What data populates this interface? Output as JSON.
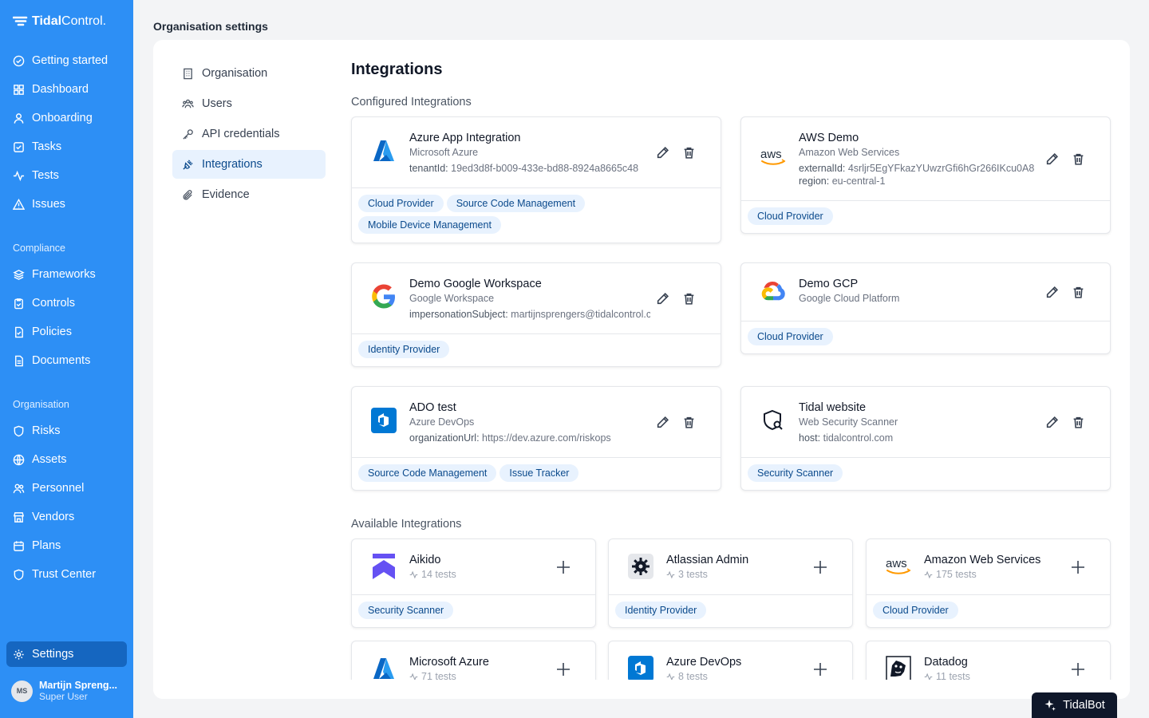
{
  "brand": {
    "part1": "Tidal",
    "part2": "Control."
  },
  "sidebar": {
    "main": [
      "Getting started",
      "Dashboard",
      "Onboarding",
      "Tasks",
      "Tests",
      "Issues"
    ],
    "compliance_label": "Compliance",
    "compliance": [
      "Frameworks",
      "Controls",
      "Policies",
      "Documents"
    ],
    "organisation_label": "Organisation",
    "organisation": [
      "Risks",
      "Assets",
      "Personnel",
      "Vendors",
      "Plans",
      "Trust Center"
    ],
    "settings": "Settings",
    "user": {
      "initials": "MS",
      "name": "Martijn Spreng...",
      "role": "Super User"
    }
  },
  "page": {
    "title": "Organisation settings"
  },
  "subnav": [
    "Organisation",
    "Users",
    "API credentials",
    "Integrations",
    "Evidence"
  ],
  "integrations": {
    "title": "Integrations",
    "configured_label": "Configured Integrations",
    "available_label": "Available Integrations",
    "configured": [
      {
        "name": "Azure App Integration",
        "provider": "Microsoft Azure",
        "meta": [
          {
            "k": "tenantId:",
            "v": "19ed3d8f-b009-433e-bd88-8924a8665c48"
          }
        ],
        "tags": [
          "Cloud Provider",
          "Source Code Management",
          "Mobile Device Management"
        ]
      },
      {
        "name": "AWS Demo",
        "provider": "Amazon Web Services",
        "meta": [
          {
            "k": "externalId:",
            "v": "4srljr5EgYFkazYUwzrGfi6hGr266IKcu0A8"
          },
          {
            "k": "region:",
            "v": "eu-central-1"
          }
        ],
        "tags": [
          "Cloud Provider"
        ]
      },
      {
        "name": "Demo Google Workspace",
        "provider": "Google Workspace",
        "meta": [
          {
            "k": "impersonationSubject:",
            "v": "martijnsprengers@tidalcontrol.com"
          }
        ],
        "tags": [
          "Identity Provider"
        ]
      },
      {
        "name": "Demo GCP",
        "provider": "Google Cloud Platform",
        "meta": [],
        "tags": [
          "Cloud Provider"
        ]
      },
      {
        "name": "ADO test",
        "provider": "Azure DevOps",
        "meta": [
          {
            "k": "organizationUrl:",
            "v": "https://dev.azure.com/riskops"
          }
        ],
        "tags": [
          "Source Code Management",
          "Issue Tracker"
        ]
      },
      {
        "name": "Tidal website",
        "provider": "Web Security Scanner",
        "meta": [
          {
            "k": "host:",
            "v": "tidalcontrol.com"
          }
        ],
        "tags": [
          "Security Scanner"
        ]
      }
    ],
    "available": [
      {
        "name": "Aikido",
        "tests": "14 tests",
        "tags": [
          "Security Scanner"
        ]
      },
      {
        "name": "Atlassian Admin",
        "tests": "3 tests",
        "tags": [
          "Identity Provider"
        ]
      },
      {
        "name": "Amazon Web Services",
        "tests": "175 tests",
        "tags": [
          "Cloud Provider"
        ]
      },
      {
        "name": "Microsoft Azure",
        "tests": "71 tests",
        "tags": []
      },
      {
        "name": "Azure DevOps",
        "tests": "8 tests",
        "tags": []
      },
      {
        "name": "Datadog",
        "tests": "11 tests",
        "tags": []
      }
    ]
  },
  "tidalbot": "TidalBot",
  "colors": {
    "sidebar": "#2d8ff5",
    "active": "#1566c0",
    "tag_bg": "#e8f2fe",
    "tag_text": "#0b4a8c"
  }
}
